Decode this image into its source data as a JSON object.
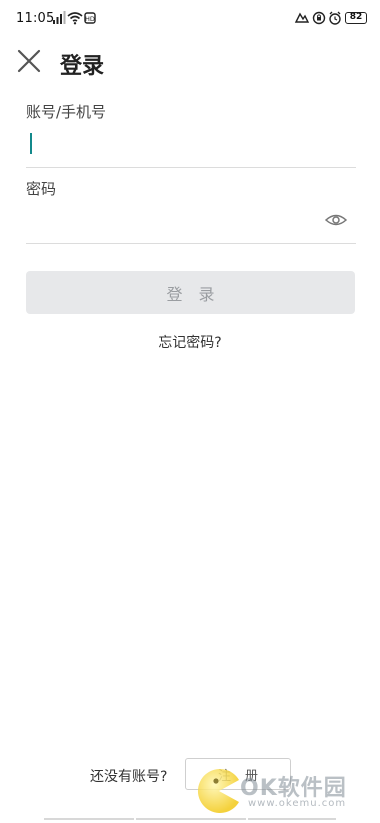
{
  "status_bar": {
    "time": "11:05",
    "battery": "82",
    "icons": [
      "signal-icon",
      "wifi-icon",
      "hd-icon",
      "hotspot-icon",
      "vpn-icon",
      "alarm-icon",
      "battery-icon"
    ]
  },
  "header": {
    "title": "登录"
  },
  "form": {
    "account_label": "账号/手机号",
    "account_value": "",
    "password_label": "密码",
    "password_value": "",
    "login_button": "登录",
    "forgot_link": "忘记密码?"
  },
  "footer": {
    "no_account_text": "还没有账号?",
    "register_button": "注册"
  },
  "watermark": {
    "brand": "OK软件园",
    "url": "www.okemu.com"
  },
  "colors": {
    "accent": "#13898b",
    "button_bg": "#e7e8ea",
    "button_text": "#9a9da1",
    "divider": "#dcdcdc"
  }
}
